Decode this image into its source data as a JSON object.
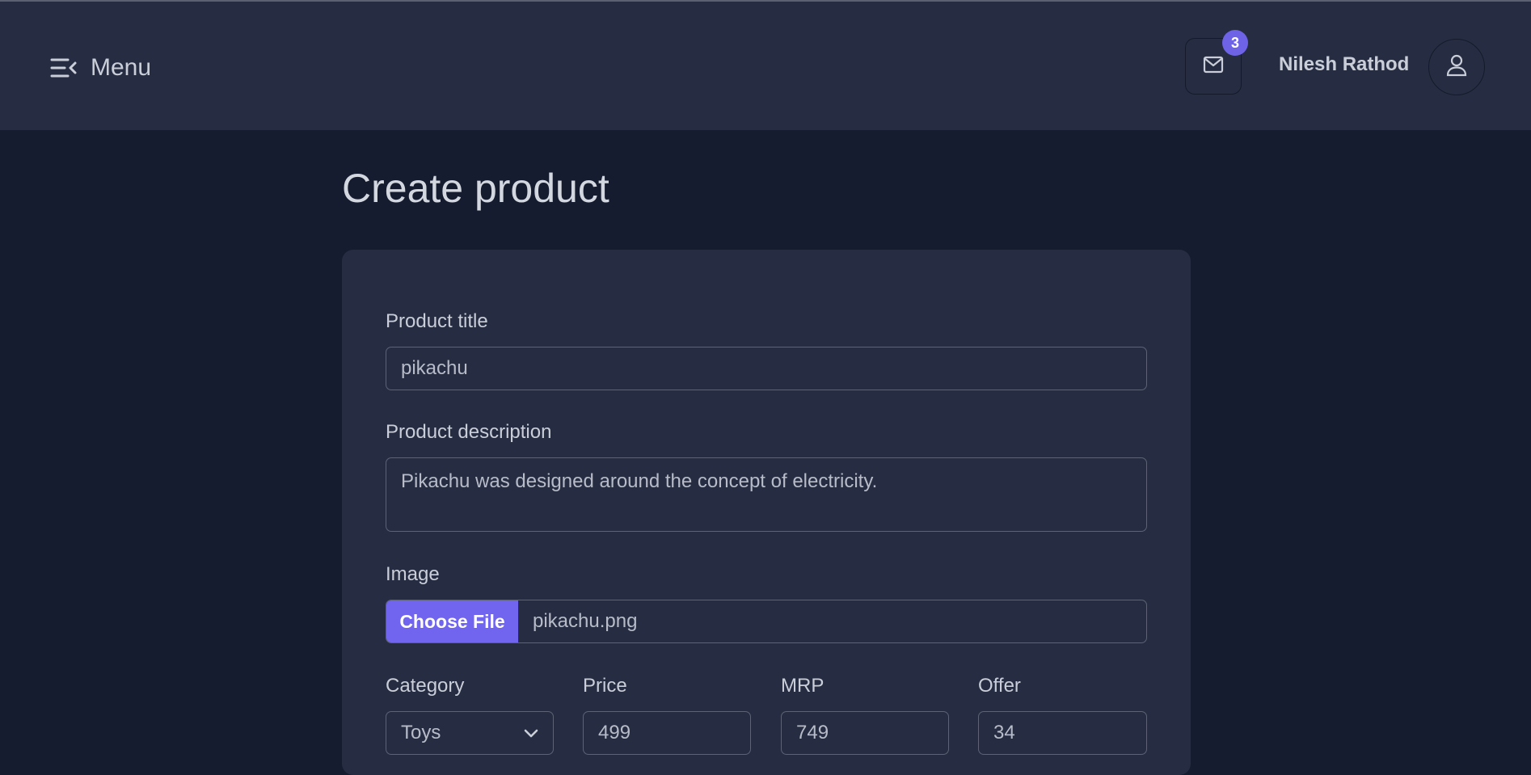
{
  "header": {
    "menu_label": "Menu",
    "notification_count": "3",
    "user_name": "Nilesh Rathod"
  },
  "page": {
    "title": "Create product"
  },
  "form": {
    "title_label": "Product title",
    "title_value": "pikachu",
    "description_label": "Product description",
    "description_value": "Pikachu was designed around the concept of electricity.",
    "image_label": "Image",
    "choose_file_label": "Choose File",
    "file_name": "pikachu.png",
    "category_label": "Category",
    "category_value": "Toys",
    "price_label": "Price",
    "price_value": "499",
    "mrp_label": "MRP",
    "mrp_value": "749",
    "offer_label": "Offer",
    "offer_value": "34"
  },
  "icons": {
    "menu": "menu-collapse-icon",
    "mail": "mail-icon",
    "user": "user-icon",
    "select": "chevron-down-icon"
  },
  "colors": {
    "background": "#161c2f",
    "surface": "#262d43",
    "accent": "#7164ef",
    "badge": "#6e63e6",
    "border": "#5d6375",
    "text": "#c9ced8"
  }
}
